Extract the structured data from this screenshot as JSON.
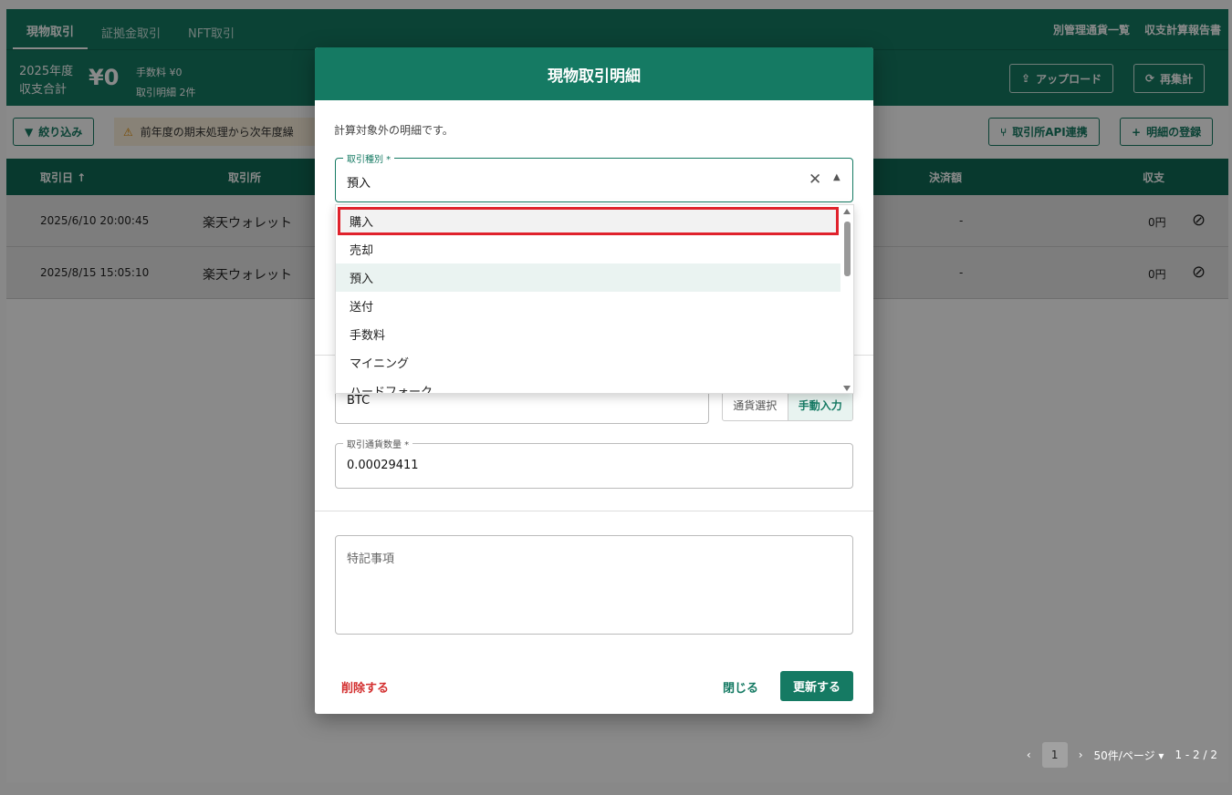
{
  "tabs": [
    "現物取引",
    "証拠金取引",
    "NFT取引"
  ],
  "top_links": [
    "別管理通貨一覧",
    "収支計算報告書"
  ],
  "summary": {
    "year": "2025年度",
    "label": "収支合計",
    "amount": "¥0",
    "fee": "手数料 ¥0",
    "count": "取引明細 2件",
    "upload": "アップロード",
    "recalc": "再集計"
  },
  "toolbar": {
    "filter": "絞り込み",
    "warning": "前年度の期末処理から次年度繰",
    "api": "取引所API連携",
    "register": "明細の登録"
  },
  "table": {
    "headers": [
      "取引日 ↑",
      "取引所",
      "決済額",
      "収支"
    ],
    "rows": [
      {
        "date": "2025/6/10 20:00:45",
        "exchange": "楽天ウォレット",
        "settle": "-",
        "pl": "0円"
      },
      {
        "date": "2025/8/15 15:05:10",
        "exchange": "楽天ウォレット",
        "settle": "-",
        "pl": "0円"
      }
    ]
  },
  "pager": {
    "page": "1",
    "per_page": "50件/ページ",
    "range": "1 - 2 / 2"
  },
  "modal": {
    "title": "現物取引明細",
    "note": "計算対象外の明細です。",
    "type_label": "取引種別 *",
    "type_value": "預入",
    "options": [
      "購入",
      "売却",
      "預入",
      "送付",
      "手数料",
      "マイニング",
      "ハードフォーク"
    ],
    "currency_value": "BTC",
    "currency_select": "通貨選択",
    "manual_input": "手動入力",
    "qty_label": "取引通貨数量 *",
    "qty_value": "0.00029411",
    "memo_placeholder": "特記事項",
    "delete": "削除する",
    "close": "閉じる",
    "update": "更新する"
  },
  "colors": {
    "brand": "#157a63",
    "danger": "#e0222c"
  }
}
